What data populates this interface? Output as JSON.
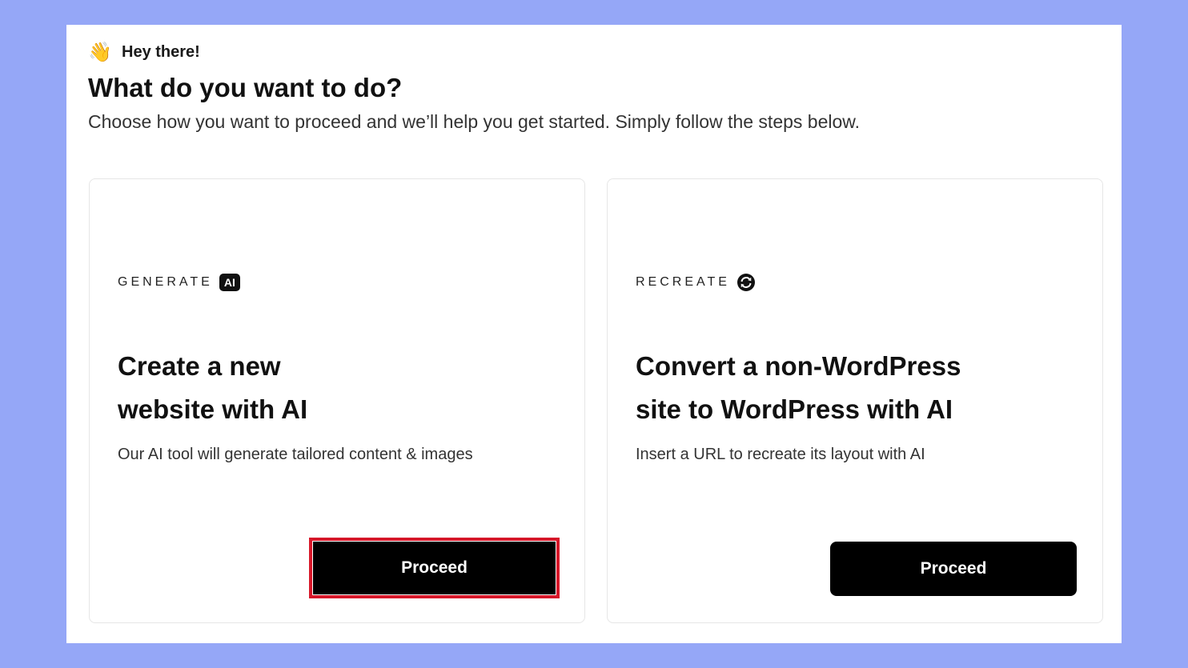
{
  "header": {
    "wave_emoji": "👋",
    "greeting": "Hey there!",
    "title": "What do you want to do?",
    "subtitle": "Choose how you want to proceed and we’ll help you get started. Simply follow the steps below."
  },
  "cards": [
    {
      "eyebrow": "GENERATE",
      "badge": "AI",
      "title_line1": "Create a new",
      "title_line2": "website with AI",
      "description": "Our AI tool will generate tailored content & images",
      "button_label": "Proceed",
      "highlighted": true
    },
    {
      "eyebrow": "RECREATE",
      "icon": "refresh-circle-icon",
      "title_line1": "Convert a non-WordPress",
      "title_line2": "site to WordPress with AI",
      "description": "Insert a URL to recreate its layout with AI",
      "button_label": "Proceed",
      "highlighted": false
    }
  ],
  "colors": {
    "background": "#95a7f7",
    "button": "#000000",
    "highlight": "#d7182a"
  }
}
